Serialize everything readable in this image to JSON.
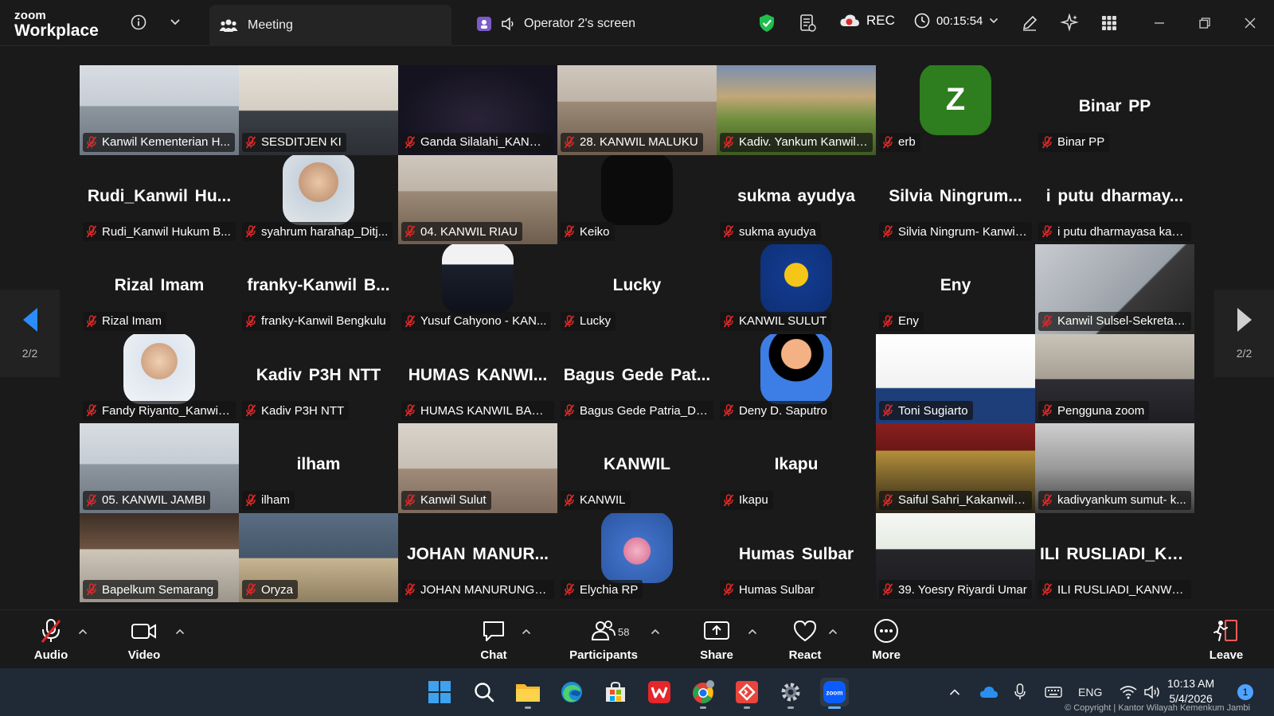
{
  "app": {
    "logo_line1": "zoom",
    "logo_line2": "Workplace"
  },
  "tab": {
    "label": "Meeting"
  },
  "share": {
    "label": "Operator 2's screen"
  },
  "recording": {
    "label": "REC",
    "elapsed": "00:15:54"
  },
  "pager": {
    "left": "2/2",
    "right": "2/2"
  },
  "tiles": [
    {
      "name": "Kanwil Kementerian H...",
      "type": "video",
      "scene": "room"
    },
    {
      "name": "SESDITJEN KI",
      "type": "video",
      "scene": "office"
    },
    {
      "name": "Ganda Silalahi_KANWI...",
      "type": "video",
      "scene": "dark"
    },
    {
      "name": "28. KANWIL MALUKU",
      "type": "video",
      "scene": "hall"
    },
    {
      "name": "Kadiv. Yankum Kanwil ...",
      "type": "video",
      "scene": "nature"
    },
    {
      "name": "erb",
      "type": "letter",
      "letter": "Z"
    },
    {
      "name": "Binar PP",
      "type": "text",
      "big": "Binar PP"
    },
    {
      "name": "Rudi_Kanwil Hukum B...",
      "type": "text",
      "big": "Rudi_Kanwil Hu..."
    },
    {
      "name": "syahrum harahap_Ditj...",
      "type": "avatar",
      "scene": "face"
    },
    {
      "name": "04. KANWIL RIAU",
      "type": "video",
      "scene": "hall"
    },
    {
      "name": "Keiko",
      "type": "avatar",
      "scene": "black"
    },
    {
      "name": "sukma ayudya",
      "type": "text",
      "big": "sukma ayudya"
    },
    {
      "name": "Silvia Ningrum- Kanwil...",
      "type": "text",
      "big": "Silvia Ningrum..."
    },
    {
      "name": "i putu dharmayasa kan...",
      "type": "text",
      "big": "i putu dharmay..."
    },
    {
      "name": "Rizal Imam",
      "type": "text",
      "big": "Rizal Imam"
    },
    {
      "name": "franky-Kanwil Bengkulu",
      "type": "text",
      "big": "franky-Kanwil B..."
    },
    {
      "name": "Yusuf Cahyono - KAN...",
      "type": "avatar",
      "scene": "poster"
    },
    {
      "name": "Lucky",
      "type": "text",
      "big": "Lucky"
    },
    {
      "name": "KANWIL SULUT",
      "type": "avatar",
      "scene": "emblem"
    },
    {
      "name": "Eny",
      "type": "text",
      "big": "Eny"
    },
    {
      "name": "Kanwil Sulsel-Sekretari...",
      "type": "video",
      "scene": "hijab"
    },
    {
      "name": "Fandy Riyanto_Kanwil ...",
      "type": "avatar",
      "scene": "face2"
    },
    {
      "name": "Kadiv P3H NTT",
      "type": "text",
      "big": "Kadiv P3H NTT"
    },
    {
      "name": "HUMAS KANWIL BABEL",
      "type": "text",
      "big": "HUMAS KANWI..."
    },
    {
      "name": "Bagus Gede Patria_DJKI",
      "type": "text",
      "big": "Bagus Gede Pat..."
    },
    {
      "name": "Deny D. Saputro",
      "type": "avatar",
      "scene": "person"
    },
    {
      "name": "Toni Sugiarto",
      "type": "video",
      "scene": "portrait"
    },
    {
      "name": "Pengguna zoom",
      "type": "video",
      "scene": "portrait2"
    },
    {
      "name": "05. KANWIL JAMBI",
      "type": "video",
      "scene": "room"
    },
    {
      "name": "ilham",
      "type": "text",
      "big": "ilham"
    },
    {
      "name": "Kanwil Sulut",
      "type": "video",
      "scene": "hall2"
    },
    {
      "name": "KANWIL",
      "type": "text",
      "big": "KANWIL"
    },
    {
      "name": "Ikapu",
      "type": "text",
      "big": "Ikapu"
    },
    {
      "name": "Saiful Sahri_Kakanwil K...",
      "type": "video",
      "scene": "official"
    },
    {
      "name": "kadivyankum sumut- k...",
      "type": "video",
      "scene": "portrait3"
    },
    {
      "name": "Bapelkum Semarang",
      "type": "video",
      "scene": "office2"
    },
    {
      "name": "Oryza",
      "type": "video",
      "scene": "uniform"
    },
    {
      "name": "JOHAN MANURUNG-KAK...",
      "type": "text",
      "big": "JOHAN MANUR..."
    },
    {
      "name": "Elychia RP",
      "type": "avatar",
      "scene": "flowers"
    },
    {
      "name": "Humas Sulbar",
      "type": "text",
      "big": "Humas Sulbar"
    },
    {
      "name": "39. Yoesry Riyardi Umar",
      "type": "video",
      "scene": "training"
    },
    {
      "name": "ILI RUSLIADI_KANWIL ...",
      "type": "text",
      "big": "ILI RUSLIADI_KA..."
    }
  ],
  "toolbar": {
    "audio": "Audio",
    "video": "Video",
    "chat": "Chat",
    "participants": "Participants",
    "participants_count": "58",
    "share": "Share",
    "react": "React",
    "more": "More",
    "leave": "Leave"
  },
  "taskbar": {
    "lang": "ENG",
    "time": "10:13 AM",
    "date": "5/4/2026",
    "notifications": "1",
    "copyright": "© Copyright | Kantor Wilayah Kemenkum Jambi"
  },
  "colors": {
    "accent": "#0b5cff",
    "mic_off": "#e02828",
    "shield": "#1fbf4e",
    "avatar_z": "#2e7d1e",
    "blue_arrow": "#2a8cff"
  }
}
